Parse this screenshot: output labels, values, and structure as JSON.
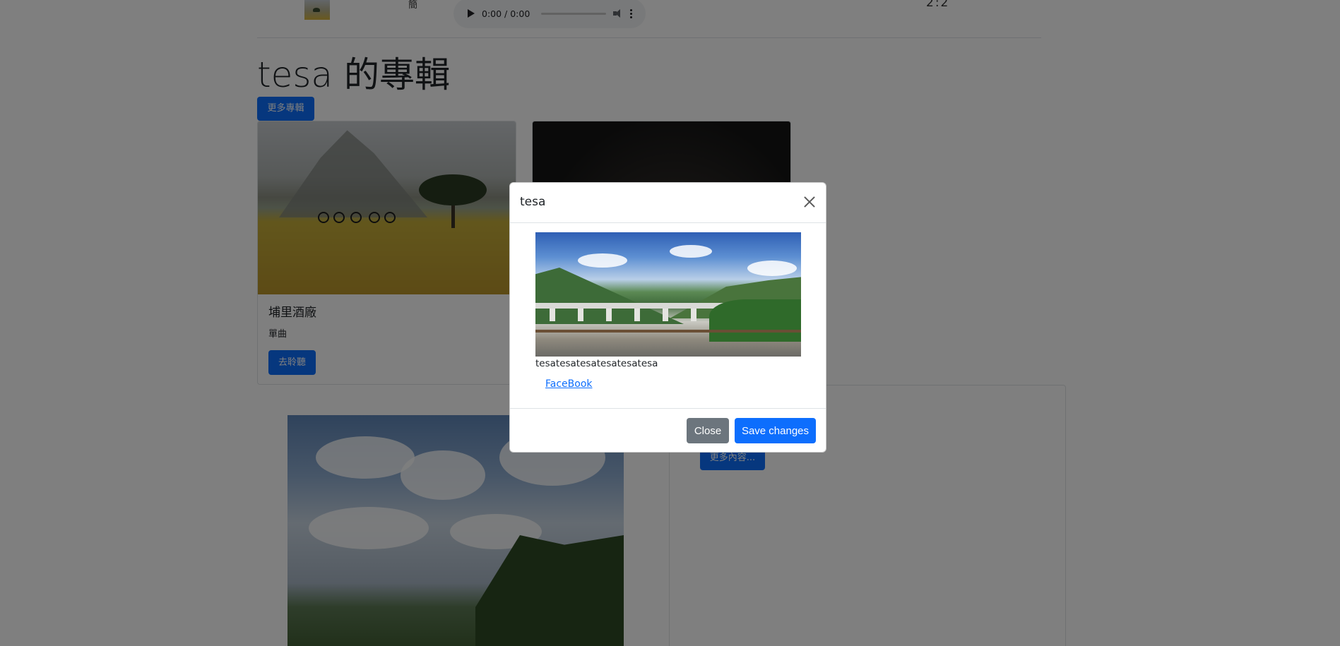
{
  "player": {
    "top_text": "簡",
    "time": "0:00 / 0:00",
    "top_right": "2:2"
  },
  "page": {
    "heading": "tesa 的專輯",
    "more_albums": "更多專輯"
  },
  "cards": [
    {
      "title": "埔里酒廠",
      "subtitle": "單曲",
      "button": "去聆聽"
    },
    {
      "title": "",
      "subtitle": "",
      "button": ""
    }
  ],
  "lower": {
    "more_content": "更多內容..."
  },
  "modal": {
    "title": "tesa",
    "body_text": "tesatesatesatesatesatesa",
    "link_text": "FaceBook",
    "close_label": "Close",
    "save_label": "Save changes"
  }
}
